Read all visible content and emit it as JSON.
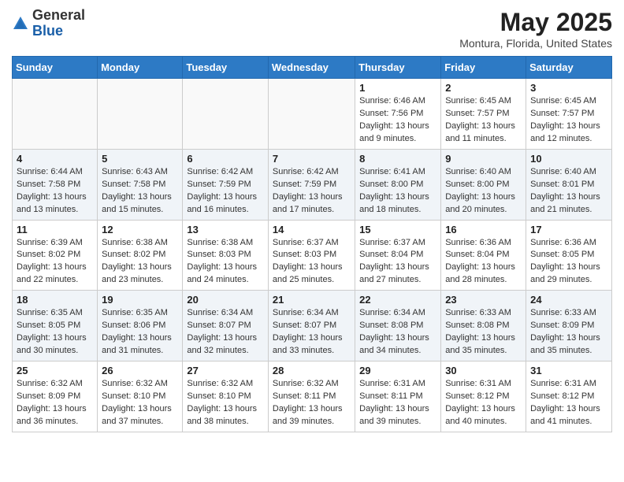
{
  "header": {
    "logo_general": "General",
    "logo_blue": "Blue",
    "title": "May 2025",
    "subtitle": "Montura, Florida, United States"
  },
  "weekdays": [
    "Sunday",
    "Monday",
    "Tuesday",
    "Wednesday",
    "Thursday",
    "Friday",
    "Saturday"
  ],
  "weeks": [
    [
      {
        "day": "",
        "info": ""
      },
      {
        "day": "",
        "info": ""
      },
      {
        "day": "",
        "info": ""
      },
      {
        "day": "",
        "info": ""
      },
      {
        "day": "1",
        "info": "Sunrise: 6:46 AM\nSunset: 7:56 PM\nDaylight: 13 hours\nand 9 minutes."
      },
      {
        "day": "2",
        "info": "Sunrise: 6:45 AM\nSunset: 7:57 PM\nDaylight: 13 hours\nand 11 minutes."
      },
      {
        "day": "3",
        "info": "Sunrise: 6:45 AM\nSunset: 7:57 PM\nDaylight: 13 hours\nand 12 minutes."
      }
    ],
    [
      {
        "day": "4",
        "info": "Sunrise: 6:44 AM\nSunset: 7:58 PM\nDaylight: 13 hours\nand 13 minutes."
      },
      {
        "day": "5",
        "info": "Sunrise: 6:43 AM\nSunset: 7:58 PM\nDaylight: 13 hours\nand 15 minutes."
      },
      {
        "day": "6",
        "info": "Sunrise: 6:42 AM\nSunset: 7:59 PM\nDaylight: 13 hours\nand 16 minutes."
      },
      {
        "day": "7",
        "info": "Sunrise: 6:42 AM\nSunset: 7:59 PM\nDaylight: 13 hours\nand 17 minutes."
      },
      {
        "day": "8",
        "info": "Sunrise: 6:41 AM\nSunset: 8:00 PM\nDaylight: 13 hours\nand 18 minutes."
      },
      {
        "day": "9",
        "info": "Sunrise: 6:40 AM\nSunset: 8:00 PM\nDaylight: 13 hours\nand 20 minutes."
      },
      {
        "day": "10",
        "info": "Sunrise: 6:40 AM\nSunset: 8:01 PM\nDaylight: 13 hours\nand 21 minutes."
      }
    ],
    [
      {
        "day": "11",
        "info": "Sunrise: 6:39 AM\nSunset: 8:02 PM\nDaylight: 13 hours\nand 22 minutes."
      },
      {
        "day": "12",
        "info": "Sunrise: 6:38 AM\nSunset: 8:02 PM\nDaylight: 13 hours\nand 23 minutes."
      },
      {
        "day": "13",
        "info": "Sunrise: 6:38 AM\nSunset: 8:03 PM\nDaylight: 13 hours\nand 24 minutes."
      },
      {
        "day": "14",
        "info": "Sunrise: 6:37 AM\nSunset: 8:03 PM\nDaylight: 13 hours\nand 25 minutes."
      },
      {
        "day": "15",
        "info": "Sunrise: 6:37 AM\nSunset: 8:04 PM\nDaylight: 13 hours\nand 27 minutes."
      },
      {
        "day": "16",
        "info": "Sunrise: 6:36 AM\nSunset: 8:04 PM\nDaylight: 13 hours\nand 28 minutes."
      },
      {
        "day": "17",
        "info": "Sunrise: 6:36 AM\nSunset: 8:05 PM\nDaylight: 13 hours\nand 29 minutes."
      }
    ],
    [
      {
        "day": "18",
        "info": "Sunrise: 6:35 AM\nSunset: 8:05 PM\nDaylight: 13 hours\nand 30 minutes."
      },
      {
        "day": "19",
        "info": "Sunrise: 6:35 AM\nSunset: 8:06 PM\nDaylight: 13 hours\nand 31 minutes."
      },
      {
        "day": "20",
        "info": "Sunrise: 6:34 AM\nSunset: 8:07 PM\nDaylight: 13 hours\nand 32 minutes."
      },
      {
        "day": "21",
        "info": "Sunrise: 6:34 AM\nSunset: 8:07 PM\nDaylight: 13 hours\nand 33 minutes."
      },
      {
        "day": "22",
        "info": "Sunrise: 6:34 AM\nSunset: 8:08 PM\nDaylight: 13 hours\nand 34 minutes."
      },
      {
        "day": "23",
        "info": "Sunrise: 6:33 AM\nSunset: 8:08 PM\nDaylight: 13 hours\nand 35 minutes."
      },
      {
        "day": "24",
        "info": "Sunrise: 6:33 AM\nSunset: 8:09 PM\nDaylight: 13 hours\nand 35 minutes."
      }
    ],
    [
      {
        "day": "25",
        "info": "Sunrise: 6:32 AM\nSunset: 8:09 PM\nDaylight: 13 hours\nand 36 minutes."
      },
      {
        "day": "26",
        "info": "Sunrise: 6:32 AM\nSunset: 8:10 PM\nDaylight: 13 hours\nand 37 minutes."
      },
      {
        "day": "27",
        "info": "Sunrise: 6:32 AM\nSunset: 8:10 PM\nDaylight: 13 hours\nand 38 minutes."
      },
      {
        "day": "28",
        "info": "Sunrise: 6:32 AM\nSunset: 8:11 PM\nDaylight: 13 hours\nand 39 minutes."
      },
      {
        "day": "29",
        "info": "Sunrise: 6:31 AM\nSunset: 8:11 PM\nDaylight: 13 hours\nand 39 minutes."
      },
      {
        "day": "30",
        "info": "Sunrise: 6:31 AM\nSunset: 8:12 PM\nDaylight: 13 hours\nand 40 minutes."
      },
      {
        "day": "31",
        "info": "Sunrise: 6:31 AM\nSunset: 8:12 PM\nDaylight: 13 hours\nand 41 minutes."
      }
    ]
  ]
}
